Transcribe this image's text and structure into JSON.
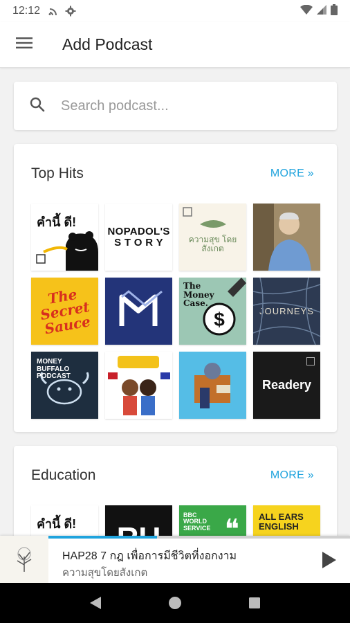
{
  "status_bar": {
    "time": "12:12"
  },
  "app_bar": {
    "title": "Add Podcast"
  },
  "search": {
    "placeholder": "Search podcast..."
  },
  "sections": [
    {
      "title": "Top Hits",
      "more_label": "MORE »",
      "podcasts": [
        {
          "name": "คำนี้ดี",
          "art_text": "คำนี้ ดี!"
        },
        {
          "name": "Nopadol's Story",
          "art_text": "NOPADOL'S S T O R Y"
        },
        {
          "name": "ความสุขโดยสังเกต",
          "art_text": "ความสุข โดยสังเกต"
        },
        {
          "name": "Portrait podcast",
          "art_text": ""
        },
        {
          "name": "The Secret Sauce",
          "art_text": "The Secret Sauce"
        },
        {
          "name": "MN podcast",
          "art_text": ""
        },
        {
          "name": "The Money Case",
          "art_text": "The Money Case."
        },
        {
          "name": "Journeys",
          "art_text": "JOURNEYS"
        },
        {
          "name": "Money Buffalo Podcast",
          "art_text": "MONEY BUFFALO PODCAST"
        },
        {
          "name": "Cartoon travel podcast",
          "art_text": ""
        },
        {
          "name": "Toy collage podcast",
          "art_text": ""
        },
        {
          "name": "Readery",
          "art_text": "Readery"
        }
      ]
    },
    {
      "title": "Education",
      "more_label": "MORE »",
      "podcasts": [
        {
          "name": "คำนี้ดี",
          "art_text": "คำนี้ ดี!"
        },
        {
          "name": "RU podcast",
          "art_text": "RU"
        },
        {
          "name": "BBC World Service",
          "art_text": "BBC WORLD SERVICE"
        },
        {
          "name": "All Ears English",
          "art_text": "ALL EARS ENGLISH"
        }
      ]
    }
  ],
  "now_playing": {
    "title": "HAP28 7 กฎ เพื่อการมีชีวิตที่งอกงาม",
    "subtitle": "ความสุขโดยสังเกต",
    "progress": 0.36
  }
}
